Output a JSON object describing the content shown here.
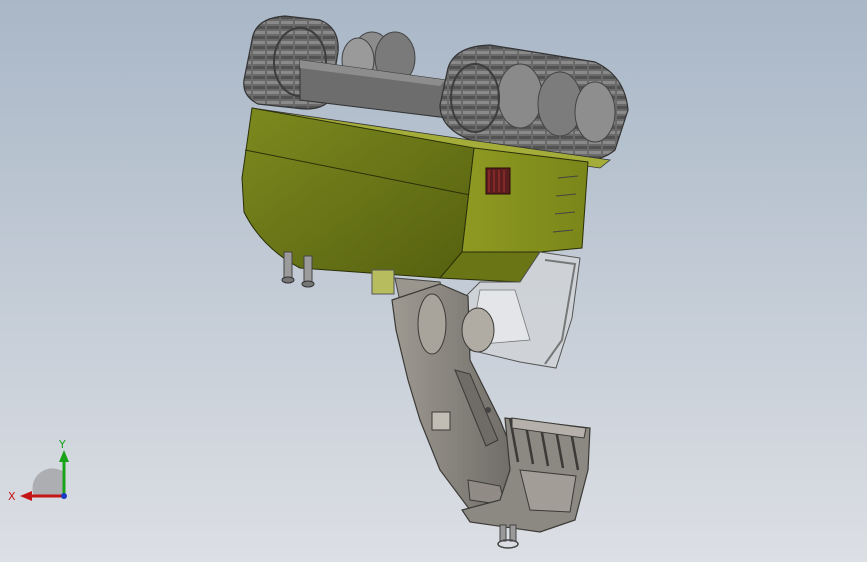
{
  "viewport": {
    "background_top": "#a8b6c6",
    "background_bottom": "#d9dde3"
  },
  "model": {
    "name": "excavator-assembly",
    "body_color": "#6e7a1c",
    "body_highlight": "#8a961e",
    "track_color": "#5c5c5c",
    "boom_color": "#8c8882",
    "glass_color": "#c9ccd0"
  },
  "triad": {
    "x_label": "X",
    "y_label": "Y",
    "x_color": "#c41616",
    "y_color": "#1aa31a",
    "z_color": "#1a3ac4"
  }
}
